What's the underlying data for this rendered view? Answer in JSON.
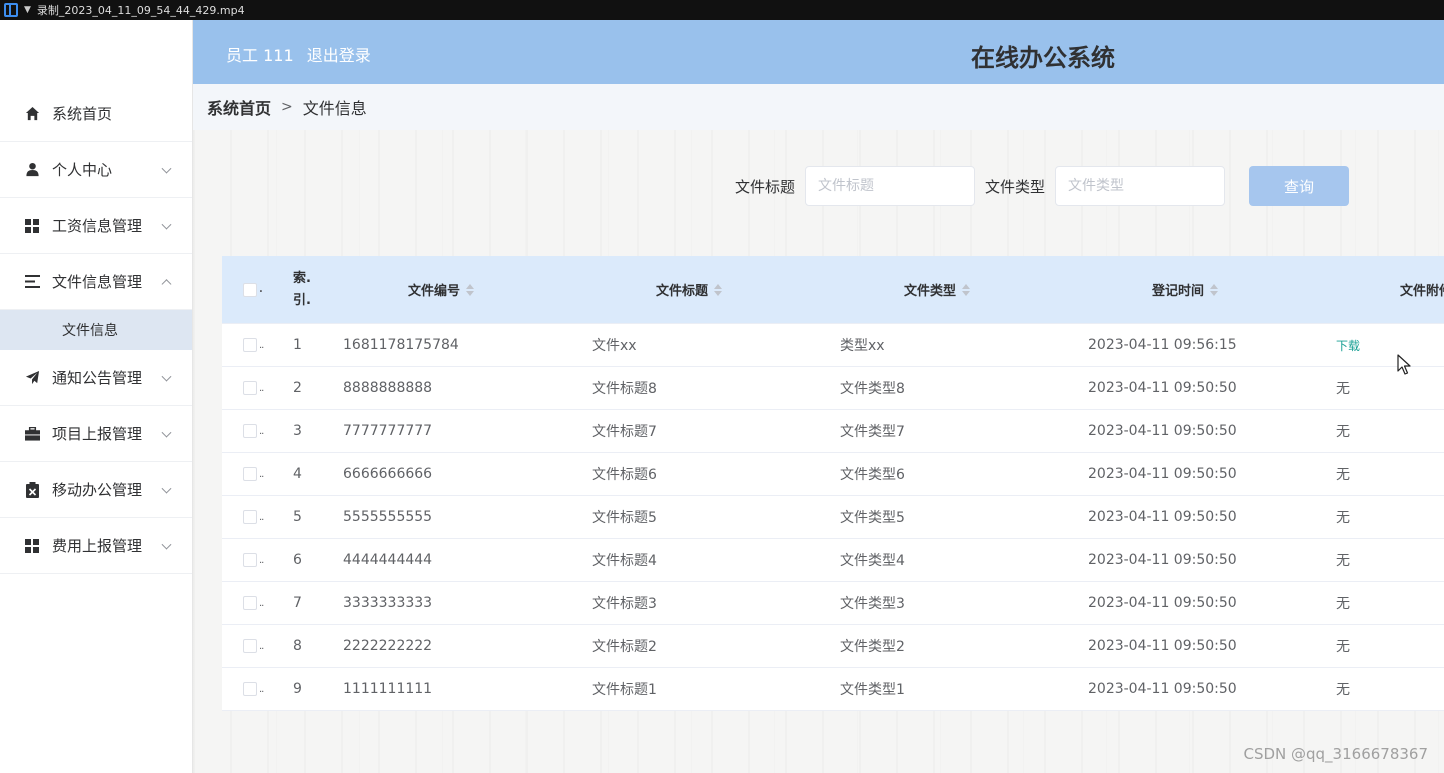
{
  "player": {
    "filename": "录制_2023_04_11_09_54_44_429.mp4"
  },
  "header": {
    "user_label": "员工 111",
    "logout_label": "退出登录",
    "app_title": "在线办公系统",
    "bg_color": "#99c1ec"
  },
  "sidebar": {
    "items": [
      {
        "label": "系统首页",
        "icon": "home-icon"
      },
      {
        "label": "个人中心",
        "icon": "user-icon"
      },
      {
        "label": "工资信息管理",
        "icon": "grid-icon"
      },
      {
        "label": "文件信息管理",
        "icon": "list-icon"
      },
      {
        "label": "通知公告管理",
        "icon": "send-icon"
      },
      {
        "label": "项目上报管理",
        "icon": "briefcase-icon"
      },
      {
        "label": "移动办公管理",
        "icon": "clipboard-icon"
      },
      {
        "label": "费用上报管理",
        "icon": "grid-icon"
      }
    ],
    "sub_item": {
      "label": "文件信息"
    }
  },
  "breadcrumb": {
    "home": "系统首页",
    "separator": ">",
    "current": "文件信息"
  },
  "search": {
    "title_label": "文件标题",
    "title_placeholder": "文件标题",
    "type_label": "文件类型",
    "type_placeholder": "文件类型",
    "button_label": "查询"
  },
  "table": {
    "headers": {
      "index": "索.引.",
      "no": "文件编号",
      "title": "文件标题",
      "type": "文件类型",
      "time": "登记时间",
      "file": "文件附件"
    },
    "rows": [
      {
        "index": "1",
        "no": "1681178175784",
        "title": "文件xx",
        "type": "类型xx",
        "time": "2023-04-11 09:56:15",
        "file": "下载"
      },
      {
        "index": "2",
        "no": "8888888888",
        "title": "文件标题8",
        "type": "文件类型8",
        "time": "2023-04-11 09:50:50",
        "file": "无"
      },
      {
        "index": "3",
        "no": "7777777777",
        "title": "文件标题7",
        "type": "文件类型7",
        "time": "2023-04-11 09:50:50",
        "file": "无"
      },
      {
        "index": "4",
        "no": "6666666666",
        "title": "文件标题6",
        "type": "文件类型6",
        "time": "2023-04-11 09:50:50",
        "file": "无"
      },
      {
        "index": "5",
        "no": "5555555555",
        "title": "文件标题5",
        "type": "文件类型5",
        "time": "2023-04-11 09:50:50",
        "file": "无"
      },
      {
        "index": "6",
        "no": "4444444444",
        "title": "文件标题4",
        "type": "文件类型4",
        "time": "2023-04-11 09:50:50",
        "file": "无"
      },
      {
        "index": "7",
        "no": "3333333333",
        "title": "文件标题3",
        "type": "文件类型3",
        "time": "2023-04-11 09:50:50",
        "file": "无"
      },
      {
        "index": "8",
        "no": "2222222222",
        "title": "文件标题2",
        "type": "文件类型2",
        "time": "2023-04-11 09:50:50",
        "file": "无"
      },
      {
        "index": "9",
        "no": "1111111111",
        "title": "文件标题1",
        "type": "文件类型1",
        "time": "2023-04-11 09:50:50",
        "file": "无"
      }
    ]
  },
  "watermark": "CSDN @qq_3166678367"
}
